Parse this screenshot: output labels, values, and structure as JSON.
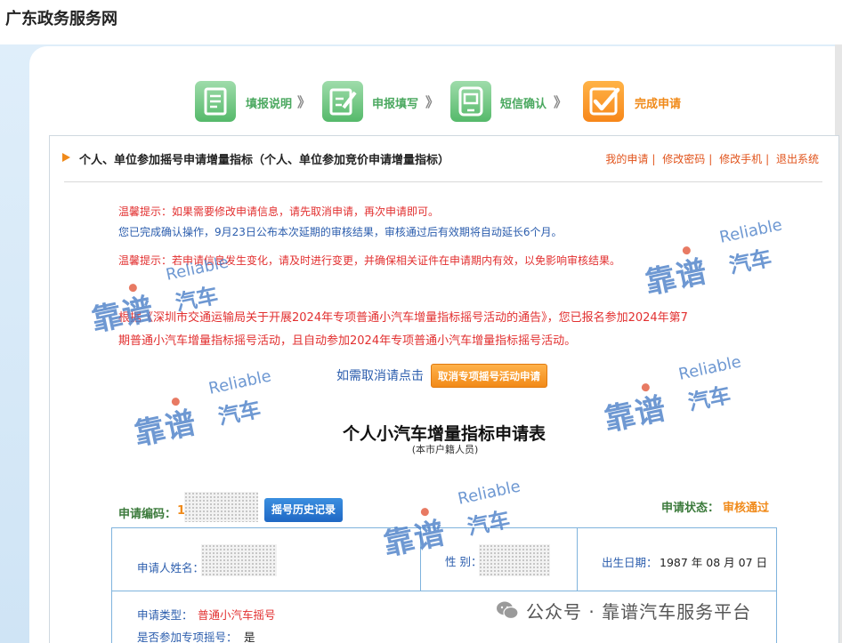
{
  "site": {
    "title": "广东政务服务网"
  },
  "steps": [
    {
      "label": "填报说明",
      "arrow": "》"
    },
    {
      "label": "申报填写",
      "arrow": "》"
    },
    {
      "label": "短信确认",
      "arrow": "》"
    },
    {
      "label": "完成申请"
    }
  ],
  "section": {
    "title": "个人、单位参加摇号申请增量指标（个人、单位参加竞价申请增量指标）"
  },
  "top_links": [
    "我的申请",
    "修改密码",
    "修改手机",
    "退出系统"
  ],
  "notices": {
    "n1": "温馨提示：如果需要修改申请信息，请先取消申请，再次申请即可。",
    "n2": "您已完成确认操作，9月23日公布本次延期的审核结果，审核通过后有效期将自动延长6个月。",
    "n3": "温馨提示：若申请信息发生变化，请及时进行变更，并确保相关证件在申请期内有效，以免影响审核结果。",
    "n4a": "根据《深圳市交通运输局关于开展2024年专项普通小汽车增量指标摇号活动的通告》，您已报名参加2024年第7",
    "n4b": "期普通小汽车增量指标摇号活动，且自动参加2024年专项普通小汽车增量指标摇号活动。"
  },
  "cancel": {
    "prompt": "如需取消请点击",
    "button": "取消专项摇号活动申请"
  },
  "form": {
    "title": "个人小汽车增量指标申请表",
    "subtitle": "(本市户籍人员)",
    "app_code_label": "申请编码：",
    "app_code_prefix": "1",
    "history_button": "摇号历史记录",
    "status_label": "申请状态：",
    "status_value": "审核通过",
    "name_label": "申请人姓名：",
    "gender_label": "性 别：",
    "birth_label": "出生日期：",
    "birth_value": "1987 年 08 月 07 日",
    "type_label": "申请类型：",
    "type_value": "普通小汽车摇号",
    "special_label": "是否参加专项摇号：",
    "special_value": "是"
  },
  "watermark": {
    "cn": "靠谱",
    "en": "Reliable",
    "car": "汽车"
  },
  "footer": {
    "text": "公众号 · 靠谱汽车服务平台",
    "icon": "wechat-icon"
  },
  "colors": {
    "accent_orange": "#f08a1a",
    "step_green": "#55b96a",
    "link_red": "#e1531b",
    "notice_red": "#e23030",
    "info_blue": "#2b5dad"
  }
}
